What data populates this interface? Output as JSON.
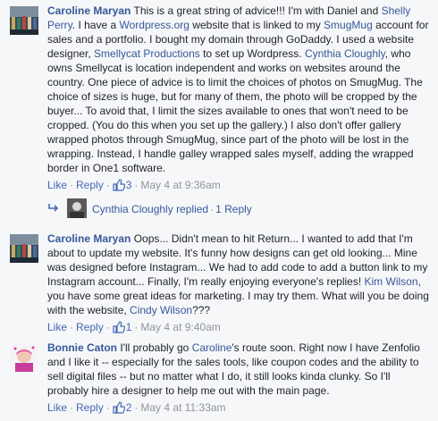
{
  "comments": [
    {
      "author": "Caroline Maryan",
      "segments": [
        {
          "t": "This is a great string of advice!!! I'm with Daniel and "
        },
        {
          "t": "Shelly Perry",
          "link": true
        },
        {
          "t": ". I have a "
        },
        {
          "t": "Wordpress.org",
          "link": true
        },
        {
          "t": " website that is linked to my "
        },
        {
          "t": "SmugMug",
          "link": true
        },
        {
          "t": " account for sales and a portfolio. I bought my domain through GoDaddy. I used a website designer, "
        },
        {
          "t": "Smellycat Productions",
          "link": true
        },
        {
          "t": " to set up Wordpress. "
        },
        {
          "t": "Cynthia Cloughly",
          "link": true
        },
        {
          "t": ", who owns Smellycat is location independent and works on websites around the country. One piece of advice is to limit the choices of photos on SmugMug. The choice of sizes is huge, but for many of them, the photo will be cropped by the buyer... To avoid that, I limit the sizes available to ones that won't need to be cropped. (You do this when you set up the gallery.) I also don't offer gallery wrapped photos through SmugMug, since part of the photo will be lost in the wrapping. Instead, I handle galley wrapped sales myself, adding the wrapped border in One1 software."
        }
      ],
      "like": "Like",
      "reply": "Reply",
      "likes": "3",
      "time": "May 4 at 9:36am"
    },
    {
      "author": "Caroline Maryan",
      "segments": [
        {
          "t": "Oops... Didn't mean to hit Return... I wanted to add that I'm about to update my website. It's funny how designs can get old looking... Mine was designed before Instagram... We had to add code to add a button link to my Instagram account... Finally, I'm really enjoying everyone's replies! "
        },
        {
          "t": "Kim Wilson",
          "link": true
        },
        {
          "t": ", you have some great ideas for marketing. I may try them. What will you be doing with the website, "
        },
        {
          "t": "Cindy Wilson",
          "link": true
        },
        {
          "t": "???"
        }
      ],
      "like": "Like",
      "reply": "Reply",
      "likes": "1",
      "time": "May 4 at 9:40am"
    },
    {
      "author": "Bonnie Caton",
      "segments": [
        {
          "t": "I'll probably go "
        },
        {
          "t": "Caroline",
          "link": true
        },
        {
          "t": "'s route soon. Right now I have Zenfolio and I like it -- especially for the sales tools, like coupon codes and the ability to sell digital files -- but no matter what I do, it still looks kinda clunky. So I'll probably hire a designer to help me out with the main page."
        }
      ],
      "like": "Like",
      "reply": "Reply",
      "likes": "2",
      "time": "May 4 at 11:33am"
    }
  ],
  "reply_summary": {
    "name": "Cynthia Cloughly",
    "verb": "replied",
    "count": "1 Reply"
  },
  "separators": {
    "dot": "·"
  },
  "colors": {
    "link": "#365899",
    "meta": "#90949c",
    "action": "#4267b2",
    "background": "#f6f7f9"
  }
}
